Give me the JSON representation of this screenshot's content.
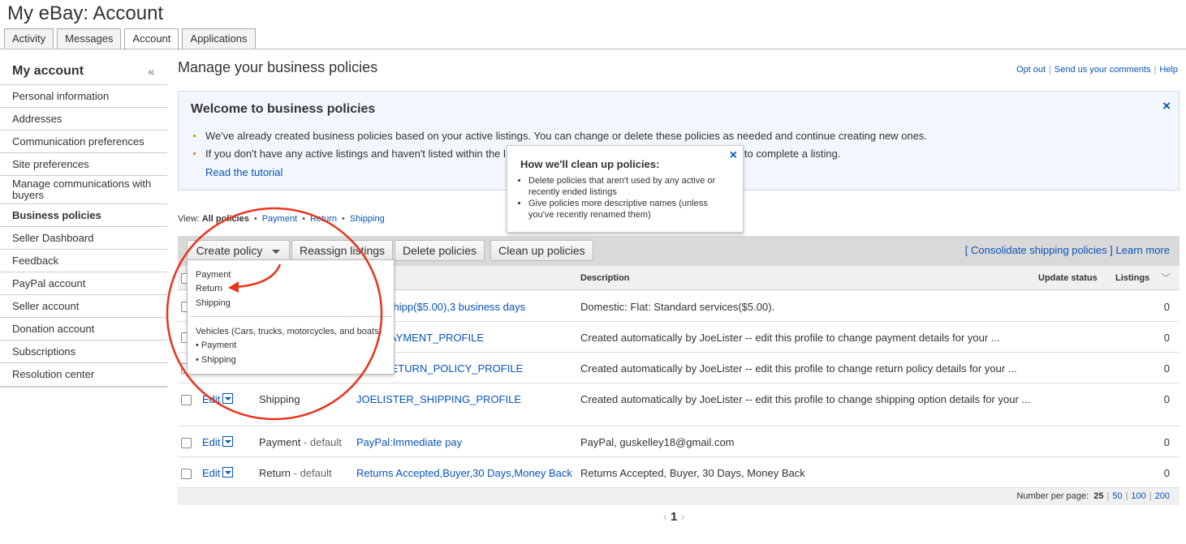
{
  "app": {
    "title": "My eBay: Account"
  },
  "tabs": [
    {
      "label": "Activity"
    },
    {
      "label": "Messages"
    },
    {
      "label": "Account"
    },
    {
      "label": "Applications"
    }
  ],
  "sidebar": {
    "title": "My account",
    "collapse": "«",
    "items": [
      {
        "label": "Personal information"
      },
      {
        "label": "Addresses"
      },
      {
        "label": "Communication preferences"
      },
      {
        "label": "Site preferences"
      },
      {
        "label": "Manage communications with buyers"
      },
      {
        "label": "Business policies"
      },
      {
        "label": "Seller Dashboard"
      },
      {
        "label": "Feedback"
      },
      {
        "label": "PayPal account"
      },
      {
        "label": "Seller account"
      },
      {
        "label": "Donation account"
      },
      {
        "label": "Subscriptions"
      },
      {
        "label": "Resolution center"
      }
    ]
  },
  "main": {
    "heading": "Manage your business policies",
    "top_links": {
      "opt_out": "Opt out",
      "comments": "Send us your comments",
      "help": "Help",
      "sep": "|"
    }
  },
  "welcome": {
    "title": "Welcome to business policies",
    "close": "×",
    "bullets": [
      "We've already created business policies based on your active listings. You can change or delete these policies as needed and continue creating new ones.",
      "If you don't have any active listings and haven't listed within the l"
    ],
    "bullet2_tail": "to complete a listing.",
    "tutorial": "Read the tutorial"
  },
  "tooltip": {
    "title": "How we'll clean up policies:",
    "close": "×",
    "items": [
      "Delete policies that aren't used by any active or recently ended listings",
      "Give policies more descriptive names (unless you've recently renamed them)"
    ]
  },
  "view": {
    "prefix": "View:",
    "all": "All policies",
    "payment": "Payment",
    "return": "Return",
    "shipping": "Shipping",
    "dot": "•"
  },
  "toolbar": {
    "create": "Create policy",
    "reassign": "Reassign listings",
    "delete": "Delete policies",
    "cleanup": "Clean up policies",
    "consolidate": "[ Consolidate shipping policies ]",
    "learn_more": "Learn more"
  },
  "table": {
    "headers": {
      "description": "Description",
      "update_status": "Update status",
      "listings": "Listings"
    },
    "edit_label": "Edit",
    "rows": [
      {
        "type": "",
        "default": "",
        "name": "ndard Shipp($5.00),3 business days",
        "desc": "Domestic: Flat: Standard services($5.00).",
        "listings": "0"
      },
      {
        "type": "",
        "default": "",
        "name": "TER_PAYMENT_PROFILE",
        "desc": "Created automatically by JoeLister -- edit this profile to change payment details for your ...",
        "listings": "0"
      },
      {
        "type": "",
        "default": "",
        "name": "TER_RETURN_POLICY_PROFILE",
        "desc": "Created automatically by JoeLister -- edit this profile to change return policy details for your ...",
        "listings": "0"
      },
      {
        "type": "Shipping",
        "default": "",
        "name": "JOELISTER_SHIPPING_PROFILE",
        "desc": "Created automatically by JoeLister -- edit this profile to change shipping option details for your ...",
        "listings": "0"
      },
      {
        "type": "Payment",
        "default": " - default",
        "name": "PayPal:Immediate pay",
        "desc": "PayPal, guskelley18@gmail.com",
        "listings": "0"
      },
      {
        "type": "Return",
        "default": " - default",
        "name": "Returns Accepted,Buyer,30 Days,Money Back",
        "desc": "Returns Accepted, Buyer, 30 Days, Money Back",
        "listings": "0"
      }
    ]
  },
  "dropdown": {
    "items": [
      "Payment",
      "Return",
      "Shipping"
    ],
    "vehicles": "Vehicles (Cars, trucks, motorcycles, and boats)",
    "vehicle_items": [
      "• Payment",
      "• Shipping"
    ]
  },
  "footer": {
    "per_page_label": "Number per page:",
    "options": [
      "25",
      "50",
      "100",
      "200"
    ],
    "current_page": "1",
    "prev": "‹",
    "next": "›"
  },
  "colors": {
    "link": "#0654ba",
    "annotation": "#e8341c",
    "bullet": "#e89a00"
  }
}
